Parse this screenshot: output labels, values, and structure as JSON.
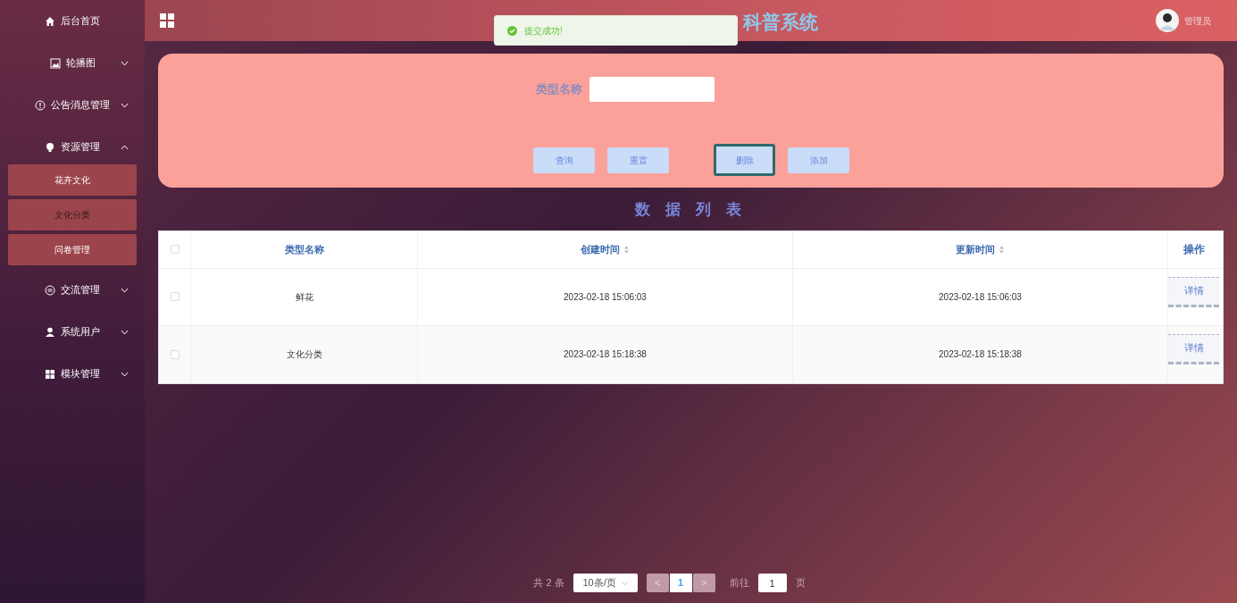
{
  "sidebar": {
    "items": [
      {
        "label": "后台首页"
      },
      {
        "label": "轮播图",
        "expanded": false
      },
      {
        "label": "公告消息管理",
        "expanded": false
      },
      {
        "label": "资源管理",
        "expanded": true,
        "children": [
          {
            "label": "花卉文化",
            "selected": false
          },
          {
            "label": "文化分类",
            "selected": true
          },
          {
            "label": "问卷管理",
            "selected": false
          }
        ]
      },
      {
        "label": "交流管理",
        "expanded": false
      },
      {
        "label": "系统用户",
        "expanded": false
      },
      {
        "label": "模块管理",
        "expanded": false
      }
    ]
  },
  "header": {
    "title": "科普系统",
    "user": "管理员"
  },
  "toast": {
    "message": "提交成功!"
  },
  "search": {
    "label": "类型名称",
    "buttons": [
      {
        "label": "查询",
        "focused": false
      },
      {
        "label": "重置",
        "focused": false
      },
      {
        "label": "删除",
        "focused": true
      },
      {
        "label": "添加",
        "focused": false
      }
    ]
  },
  "list_title": "数 据 列 表",
  "table": {
    "all_checked": false,
    "columns": [
      {
        "label": "类型名称",
        "sortable": false
      },
      {
        "label": "创建时间",
        "sortable": true
      },
      {
        "label": "更新时间",
        "sortable": true
      },
      {
        "label": "操作",
        "sortable": false
      }
    ],
    "rows": [
      {
        "checked": false,
        "cells": [
          "鲜花",
          "2023-02-18 15:06:03",
          "2023-02-18 15:06:03"
        ],
        "action": "详情"
      },
      {
        "checked": false,
        "cells": [
          "文化分类",
          "2023-02-18 15:18:38",
          "2023-02-18 15:18:38"
        ],
        "action": "详情"
      }
    ]
  },
  "pagination": {
    "total": "共 2 条",
    "page_size": "10条/页",
    "prev": "<",
    "page": "1",
    "next": ">",
    "goto": "前往",
    "goto_value": "1",
    "goto_suffix": "页"
  }
}
